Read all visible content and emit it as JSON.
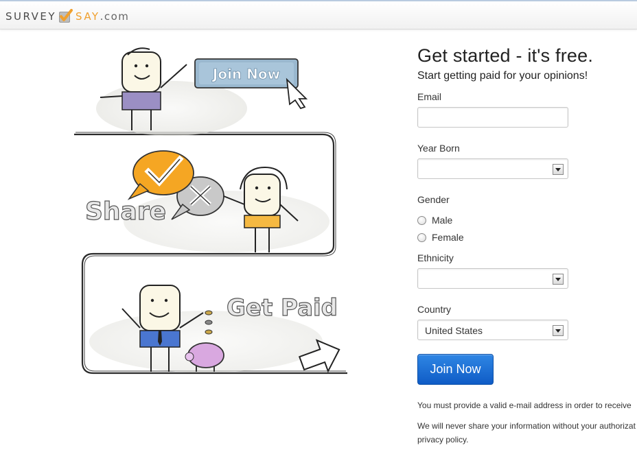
{
  "header": {
    "logo_part1": "SURVEY",
    "logo_part2": "SAY",
    "logo_part3": ".com"
  },
  "illustration": {
    "join_sign": "Join Now",
    "share_text": "Share",
    "get_paid_text": "Get Paid"
  },
  "form": {
    "title": "Get started - it's free.",
    "subtitle": "Start getting paid for your opinions!",
    "email_label": "Email",
    "email_value": "",
    "year_born_label": "Year Born",
    "year_born_value": "",
    "gender_label": "Gender",
    "gender_options": [
      "Male",
      "Female"
    ],
    "ethnicity_label": "Ethnicity",
    "ethnicity_value": "",
    "country_label": "Country",
    "country_value": "United States",
    "join_button": "Join Now",
    "note1": "You must provide a valid e-mail address in order to receive",
    "note2_line1": "We will never share your information without your authorizat",
    "note2_line2": "privacy policy."
  },
  "colors": {
    "accent_orange": "#f0a02e",
    "button_blue": "#1a6ad6"
  }
}
